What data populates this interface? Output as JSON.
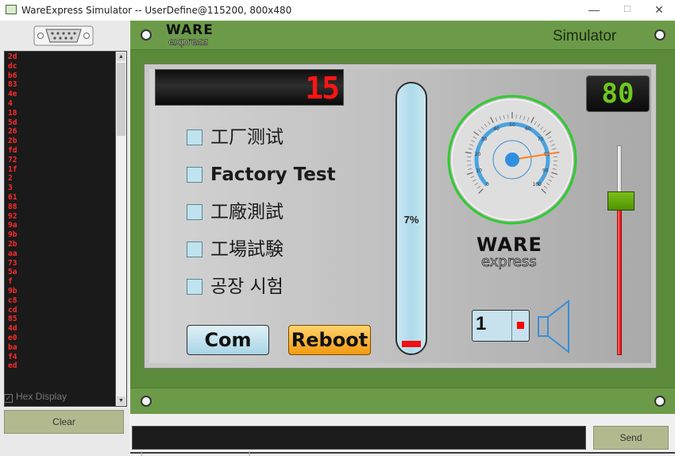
{
  "window": {
    "title": "WareExpress Simulator -- UserDefine@115200, 800x480",
    "minimize": "—",
    "maximize": "☐",
    "close": "✕"
  },
  "log": {
    "lines": [
      "2d",
      "dc",
      "b6",
      "83",
      "4e",
      "4",
      "18",
      "5d",
      "26",
      "2b",
      "fd",
      "72",
      "1f",
      "2",
      "3",
      "61",
      "88",
      "92",
      "9a",
      "9b",
      "2b",
      "aa",
      "73",
      "5a",
      "f",
      "9b",
      "c8",
      "cd",
      "85",
      "4d",
      "e0",
      "ba",
      "f4",
      "ed"
    ],
    "text_color": "#ff2a2a",
    "background": "#1a1a1a"
  },
  "hex_display": {
    "label": "Hex Display",
    "checked": true,
    "check_glyph": "✓"
  },
  "clear_button": {
    "label": "Clear"
  },
  "header": {
    "logo_top": "WARE",
    "logo_bottom": "express",
    "simulator_label": "Simulator"
  },
  "display": {
    "counter_value": "15",
    "secondary_value": "80"
  },
  "checkboxes": [
    {
      "label": "工厂测试",
      "checked": false
    },
    {
      "label": "Factory Test",
      "checked": false
    },
    {
      "label": "工廠測試",
      "checked": false
    },
    {
      "label": "工場試験",
      "checked": false
    },
    {
      "label": "공장 시험",
      "checked": false
    }
  ],
  "buttons": {
    "com": "Com",
    "reboot": "Reboot"
  },
  "thermometer": {
    "percent_label": "7%",
    "level": 0.07,
    "fill_color": "#f01010"
  },
  "gauge": {
    "ticks": [
      "0",
      "10",
      "20",
      "30",
      "40",
      "50",
      "60",
      "70",
      "80",
      "90",
      "100"
    ],
    "value": 80,
    "ring_color": "#2ecc2e",
    "arc_color": "#4aa3df",
    "needle_color": "#ff7f1e"
  },
  "screen_logo": {
    "top": "WARE",
    "bottom": "express"
  },
  "spinner": {
    "value": "1"
  },
  "slider": {
    "level": 0.78,
    "knob_color": "#5aa10c",
    "track_color": "#e50c0c"
  },
  "send_button": {
    "label": "Send"
  },
  "colors": {
    "frame_green": "#6b9b48",
    "button_olive": "#b3b98f",
    "seven_seg_red": "#ff1414",
    "seven_seg_green": "#6fc81c"
  }
}
